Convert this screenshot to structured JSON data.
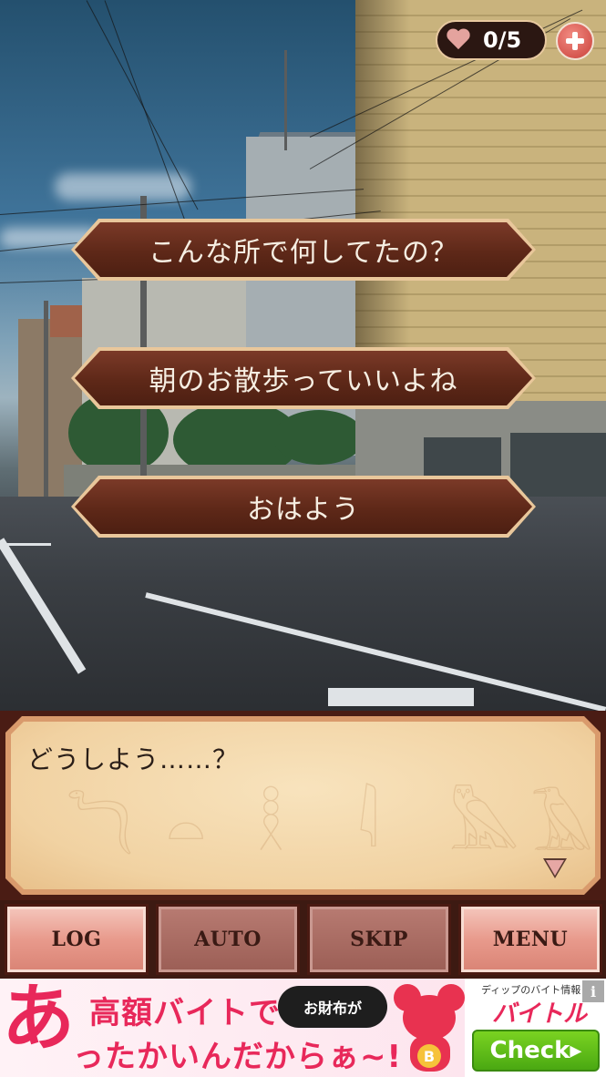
{
  "hearts": {
    "count_text": "0/5",
    "current": 0,
    "max": 5
  },
  "choices": [
    {
      "label": "こんな所で何してたの？"
    },
    {
      "label": "朝のお散歩っていいよね"
    },
    {
      "label": "おはよう"
    }
  ],
  "dialogue": {
    "text": "どうしよう……？"
  },
  "menu": {
    "log_label": "LOG",
    "auto_label": "AUTO",
    "skip_label": "SKIP",
    "menu_label": "MENU"
  },
  "ad": {
    "big_char": "あ",
    "line1": "高額バイトで",
    "wallet_text": "お財布が",
    "line2": "ったかいんだからぁ~!",
    "mouse_badge": "B",
    "small_text": "ディップのバイト情報",
    "brand": "バイトル",
    "check_label": "Check▸",
    "info_label": "i"
  },
  "colors": {
    "choice_fill": "#5e2818",
    "choice_border": "#e9c79b",
    "dialog_paper": "#f1d2a2",
    "menu_button_light": "#e89a8c",
    "menu_button_dark": "#9b5e55",
    "ad_accent": "#e8285a"
  },
  "icons": {
    "hearts": "heart-icon",
    "add": "plus-icon",
    "advance": "triangle-down-icon"
  }
}
